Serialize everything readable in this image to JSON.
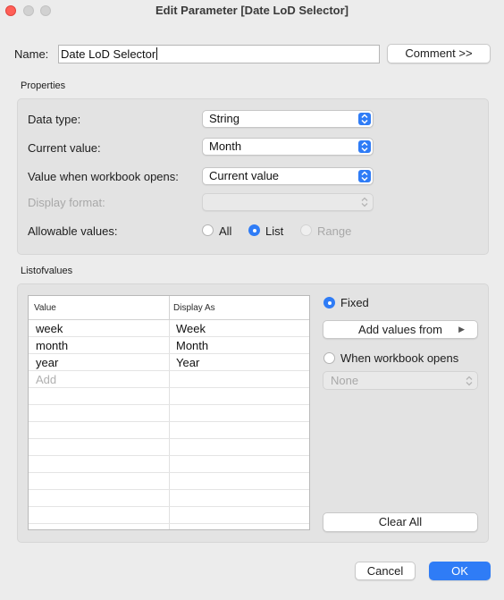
{
  "window": {
    "title": "Edit Parameter [Date LoD Selector]"
  },
  "name_row": {
    "label": "Name:",
    "value": "Date LoD Selector",
    "comment_button": "Comment >>"
  },
  "properties": {
    "title": "Properties",
    "data_type": {
      "label": "Data type:",
      "value": "String"
    },
    "current_value": {
      "label": "Current value:",
      "value": "Month"
    },
    "workbook_opens": {
      "label": "Value when workbook opens:",
      "value": "Current value"
    },
    "display_format": {
      "label": "Display format:",
      "value": ""
    },
    "allowable_values": {
      "label": "Allowable values:",
      "options": [
        "All",
        "List",
        "Range"
      ],
      "selected": "List"
    }
  },
  "list_of_values": {
    "title": "Listofvalues",
    "columns": [
      "Value",
      "Display As"
    ],
    "rows": [
      {
        "value": "week",
        "display": "Week"
      },
      {
        "value": "month",
        "display": "Month"
      },
      {
        "value": "year",
        "display": "Year"
      }
    ],
    "add_placeholder": "Add",
    "fixed_label": "Fixed",
    "add_values_from": "Add values from",
    "when_workbook_opens": "When workbook opens",
    "none_select": "None",
    "clear_all": "Clear All"
  },
  "footer": {
    "cancel": "Cancel",
    "ok": "OK"
  },
  "colors": {
    "accent": "#2f7cf6",
    "close": "#ff5f57"
  }
}
